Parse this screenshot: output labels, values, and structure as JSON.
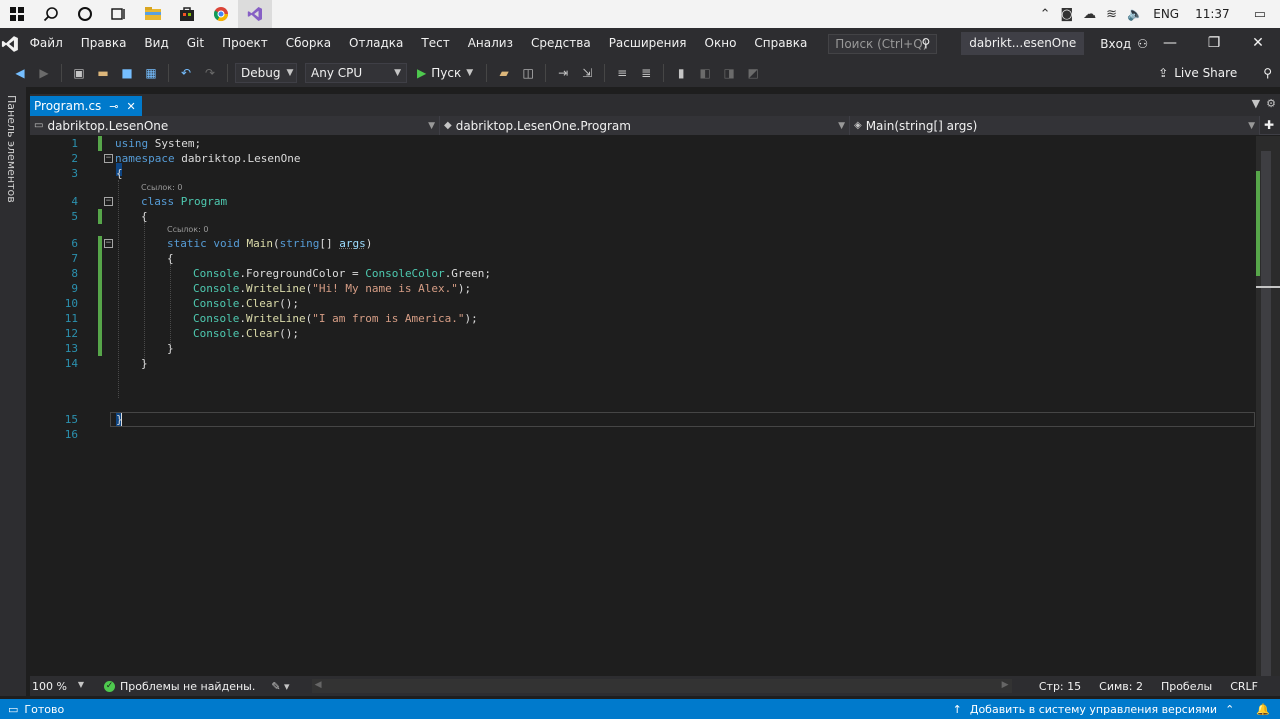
{
  "taskbar": {
    "lang": "ENG",
    "time": "11:37"
  },
  "menubar": {
    "items": [
      "Файл",
      "Правка",
      "Вид",
      "Git",
      "Проект",
      "Сборка",
      "Отладка",
      "Тест",
      "Анализ",
      "Средства",
      "Расширения",
      "Окно",
      "Справка"
    ],
    "search_placeholder": "Поиск (Ctrl+Q)",
    "solution_name": "dabrikt...esenOne",
    "login_label": "Вход"
  },
  "toolbar": {
    "config": "Debug",
    "platform": "Any CPU",
    "run_label": "Пуск",
    "live_share": "Live Share"
  },
  "left_panel": {
    "toolbox_label": "Панель элементов"
  },
  "document": {
    "tab_label": "Program.cs",
    "nav": {
      "project": "dabriktop.LesenOne",
      "type": "dabriktop.LesenOne.Program",
      "member": "Main(string[] args)"
    }
  },
  "editor": {
    "line_numbers": [
      "1",
      "2",
      "3",
      "4",
      "5",
      "6",
      "7",
      "8",
      "9",
      "10",
      "11",
      "12",
      "13",
      "14",
      "15",
      "16"
    ],
    "codelens_refs": "Ссылок: 0",
    "lines": {
      "l1": [
        "using",
        " System;"
      ],
      "l2": [
        "namespace",
        " dabriktop.LesenOne"
      ],
      "l3": "{",
      "l4": [
        "class",
        " ",
        "Program"
      ],
      "l5": "{",
      "l6": [
        "static",
        " ",
        "void",
        " ",
        "Main",
        "(",
        "string",
        "[] ",
        "args",
        ")"
      ],
      "l7": "{",
      "l8": [
        "Console",
        ".ForegroundColor = ",
        "ConsoleColor",
        ".Green;"
      ],
      "l9": [
        "Console",
        ".",
        "WriteLine",
        "(",
        "\"Hi! My name is Alex.\"",
        ");"
      ],
      "l10": [
        "Console",
        ".",
        "Clear",
        "();"
      ],
      "l11": [
        "Console",
        ".",
        "WriteLine",
        "(",
        "\"I am from is America.\"",
        ");"
      ],
      "l12": [
        "Console",
        ".",
        "Clear",
        "();"
      ],
      "l13": "}",
      "l14": "}",
      "l15": "}"
    }
  },
  "editor_status": {
    "zoom": "100 %",
    "problems": "Проблемы не найдены.",
    "line": "Стр: 15",
    "col": "Симв: 2",
    "whitespace": "Пробелы",
    "eol": "CRLF"
  },
  "statusbar": {
    "ready": "Готово",
    "add_to_vcs": "Добавить в систему управления версиями"
  },
  "colors": {
    "vs_accent": "#007acc",
    "keyword": "#569cd6",
    "type": "#4ec9b0",
    "method": "#dcdcaa",
    "string": "#d69d85",
    "line_number": "#2b91af"
  }
}
